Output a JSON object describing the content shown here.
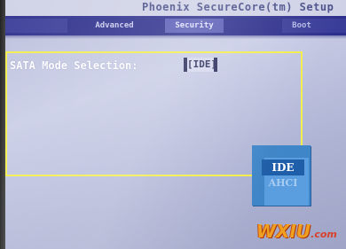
{
  "header": {
    "title": "Phoenix SecureCore(tm) Setup"
  },
  "menu": {
    "tabs": [
      {
        "label": "Advanced"
      },
      {
        "label": "Security"
      },
      {
        "label": "Boot"
      }
    ]
  },
  "setting": {
    "label": "SATA Mode Selection:",
    "value": "[IDE]"
  },
  "popup": {
    "options": [
      "IDE",
      "AHCI"
    ],
    "selected": "IDE"
  },
  "watermark": {
    "main": "WXIU",
    "suffix": ".com"
  },
  "colors": {
    "screen_background": "#c9cde6",
    "menubar": "#2d2f8c",
    "highlight_frame": "#f2ee4a",
    "popup": "#3f86c8",
    "popup_selected": "#1f5ea8"
  }
}
